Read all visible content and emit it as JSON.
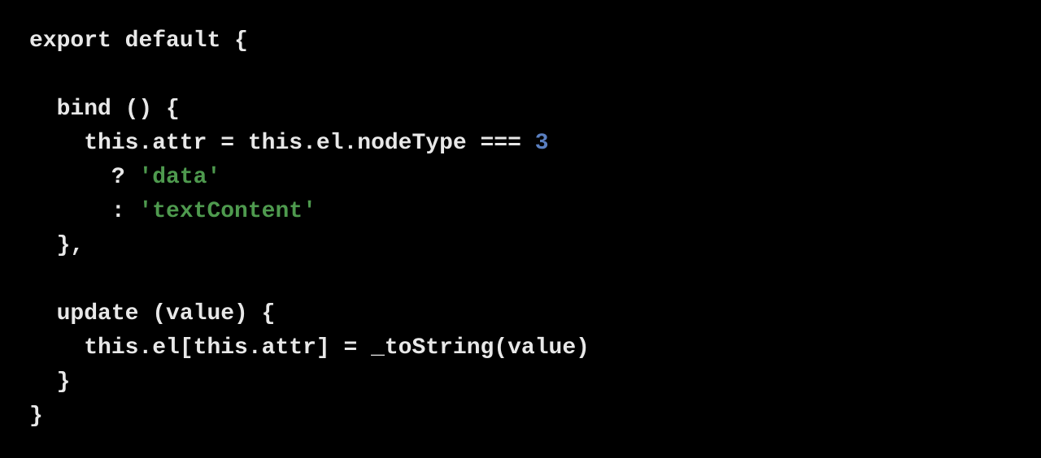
{
  "code": {
    "line1": {
      "kw_export": "export",
      "kw_default": "default",
      "brace_open": " {"
    },
    "line3": {
      "indent": "  ",
      "method": "bind () {"
    },
    "line4": {
      "indent": "    ",
      "lhs": "this.attr = this.el.nodeType === ",
      "num": "3"
    },
    "line5": {
      "indent": "      ",
      "op": "? ",
      "str": "'data'"
    },
    "line6": {
      "indent": "      ",
      "op": ": ",
      "str": "'textContent'"
    },
    "line7": {
      "indent": "  ",
      "close": "},"
    },
    "line9": {
      "indent": "  ",
      "method": "update (value) {"
    },
    "line10": {
      "indent": "    ",
      "stmt": "this.el[this.attr] = _toString(value)"
    },
    "line11": {
      "indent": "  ",
      "close": "}"
    },
    "line12": {
      "close": "}"
    }
  }
}
